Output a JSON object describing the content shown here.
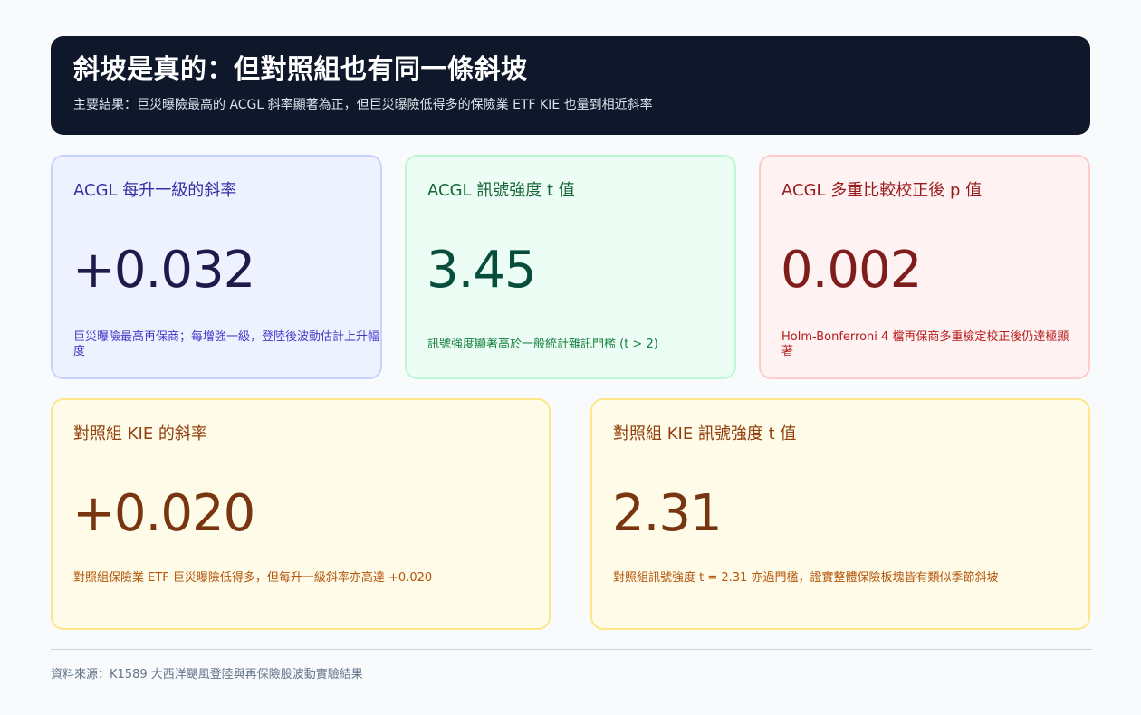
{
  "header": {
    "title": "斜坡是真的：但對照組也有同一條斜坡",
    "subtitle": "主要結果：巨災曝險最高的 ACGL 斜率顯著為正，但巨災曝險低得多的保險業 ETF KIE 也量到相近斜率"
  },
  "cards": [
    {
      "label": "ACGL 每升一級的斜率",
      "value": "+0.032",
      "note": "巨災曝險最高再保商；每增強一級，登陸後波動估計上升幅度",
      "colors": {
        "bg": "#eef2ff",
        "border": "#c7d2fe",
        "value": "#1e1b4b"
      }
    },
    {
      "label": "ACGL 訊號強度 t 值",
      "value": "3.45",
      "note": "訊號強度顯著高於一般統計雜訊門檻 (t > 2)",
      "colors": {
        "bg": "#ecfdf5",
        "border": "#bbf7d0",
        "value": "#064e3b"
      }
    },
    {
      "label": "ACGL 多重比較校正後 p 值",
      "value": "0.002",
      "note": "Holm-Bonferroni 4 檔再保商多重檢定校正後仍達極顯著",
      "colors": {
        "bg": "#fef2f2",
        "border": "#fecaca",
        "value": "#7f1d1d"
      }
    },
    {
      "label": "對照組 KIE 的斜率",
      "value": "+0.020",
      "note": "對照組保險業 ETF 巨災曝險低得多，但每升一級斜率亦高達 +0.020",
      "colors": {
        "bg": "#fefce8",
        "border": "#fde68a",
        "value": "#78350f"
      }
    },
    {
      "label": "對照組 KIE 訊號強度 t 值",
      "value": "2.31",
      "note": "對照組訊號強度 t = 2.31 亦過門檻，證實整體保險板塊皆有類似季節斜坡",
      "colors": {
        "bg": "#fefce8",
        "border": "#fde68a",
        "value": "#78350f"
      }
    }
  ],
  "footer": {
    "source": "資料來源：K1589 大西洋颶風登陸與再保險股波動實驗結果"
  }
}
